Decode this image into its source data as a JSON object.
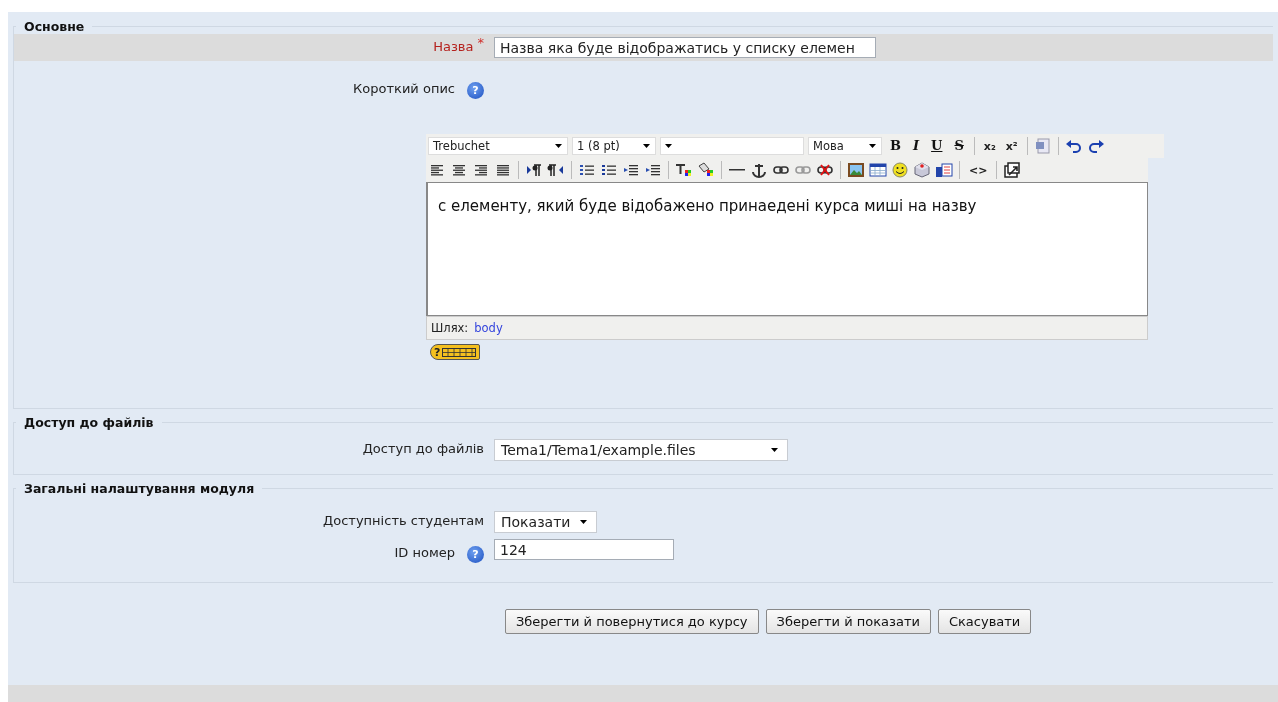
{
  "sections": [
    {
      "legend": "Основне",
      "rows": [
        {
          "kind": "text",
          "label": "Назва",
          "required_mark": "*",
          "highlighted": true,
          "value": "Назва яка буде відображатись у списку елемен"
        },
        {
          "kind": "editor",
          "label": "Короткий опис",
          "help": "?",
          "highlighted": false
        }
      ]
    },
    {
      "legend": "Доступ до файлів",
      "rows": [
        {
          "kind": "select",
          "label": "Доступ до файлів",
          "value": "Tema1/Tema1/example.files",
          "highlighted": false
        }
      ]
    },
    {
      "legend": "Загальні налаштування модуля",
      "rows": [
        {
          "kind": "select",
          "label": "Доступність студентам",
          "value": "Показати",
          "highlighted": false
        },
        {
          "kind": "text",
          "label": "ID номер",
          "help": "?",
          "value": "124",
          "highlighted": false
        }
      ]
    }
  ],
  "editor": {
    "font": "Trebuchet",
    "size": "1 (8 pt)",
    "language": "Мова",
    "format_buttons": [
      "B",
      "I",
      "U",
      "S"
    ],
    "script_buttons": [
      "x₂",
      "x²"
    ],
    "source_button": "<>",
    "content": "с елементу, який буде відобажено принаедені курса миші на назву",
    "path_label": "Шлях:",
    "path": "body",
    "keyboard_help": "?"
  },
  "buttons": [
    "Зберегти й повернутися до курсу",
    "Зберегти й показати",
    "Скасувати"
  ]
}
